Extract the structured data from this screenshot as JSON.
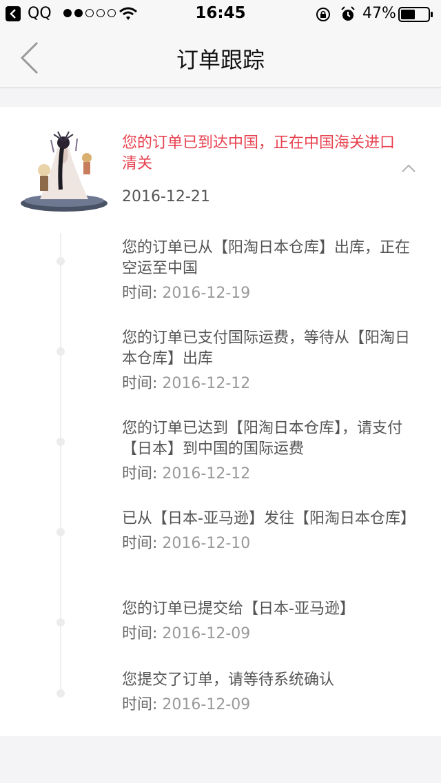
{
  "status_bar": {
    "app": "QQ",
    "time": "16:45",
    "battery": "47%"
  },
  "nav": {
    "title": "订单跟踪"
  },
  "order": {
    "latest_status": "您的订单已到达中国，正在中国海关进口清关",
    "latest_date": "2016-12-21",
    "time_label": "时间:",
    "events": [
      {
        "text": "您的订单已从【阳淘日本仓库】出库，正在空运至中国",
        "time": "2016-12-19"
      },
      {
        "text": "您的订单已支付国际运费，等待从【阳淘日本仓库】出库",
        "time": "2016-12-12"
      },
      {
        "text": "您的订单已达到【阳淘日本仓库】，请支付【日本】到中国的国际运费",
        "time": "2016-12-12"
      },
      {
        "text": "已从【日本-亚马逊】发往【阳淘日本仓库】",
        "time": "2016-12-10"
      },
      {
        "text": "您的订单已提交给【日本-亚马逊】",
        "time": "2016-12-09"
      },
      {
        "text": "您提交了订单，请等待系统确认",
        "time": "2016-12-09"
      }
    ]
  },
  "colors": {
    "accent": "#e8424f",
    "text": "#555555",
    "muted": "#999999"
  }
}
